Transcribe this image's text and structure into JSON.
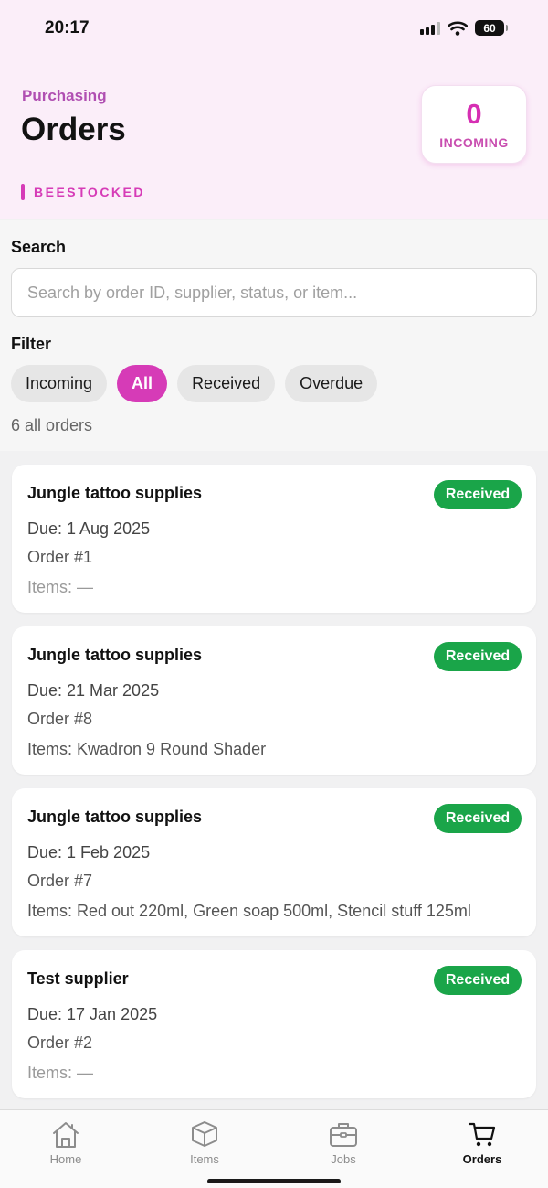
{
  "status_bar": {
    "time": "20:17",
    "battery": "60"
  },
  "header": {
    "eyebrow": "Purchasing",
    "title": "Orders",
    "brand": "BEESTOCKED",
    "incoming": {
      "count": "0",
      "label": "INCOMING"
    }
  },
  "search": {
    "label": "Search",
    "placeholder": "Search by order ID, supplier, status, or item...",
    "value": ""
  },
  "filter": {
    "label": "Filter",
    "chips": [
      "Incoming",
      "All",
      "Received",
      "Overdue"
    ],
    "selected": "All",
    "count_text": "6 all orders"
  },
  "orders": [
    {
      "supplier": "Jungle tattoo supplies",
      "status": "Received",
      "due": "Due: 1 Aug 2025",
      "order": "Order #1",
      "items": "Items: —"
    },
    {
      "supplier": "Jungle tattoo supplies",
      "status": "Received",
      "due": "Due: 21 Mar 2025",
      "order": "Order #8",
      "items": "Items: Kwadron 9 Round Shader"
    },
    {
      "supplier": "Jungle tattoo supplies",
      "status": "Received",
      "due": "Due: 1 Feb 2025",
      "order": "Order #7",
      "items": "Items: Red out 220ml, Green soap 500ml, Stencil stuff 125ml"
    },
    {
      "supplier": "Test supplier",
      "status": "Received",
      "due": "Due: 17 Jan 2025",
      "order": "Order #2",
      "items": "Items: —"
    }
  ],
  "tabs": [
    {
      "label": "Home",
      "icon": "home-icon"
    },
    {
      "label": "Items",
      "icon": "box-icon"
    },
    {
      "label": "Jobs",
      "icon": "briefcase-icon"
    },
    {
      "label": "Orders",
      "icon": "cart-icon",
      "active": true
    }
  ],
  "colors": {
    "accent": "#d63bb7",
    "received": "#1aa549",
    "header_bg": "#fbeef9"
  }
}
